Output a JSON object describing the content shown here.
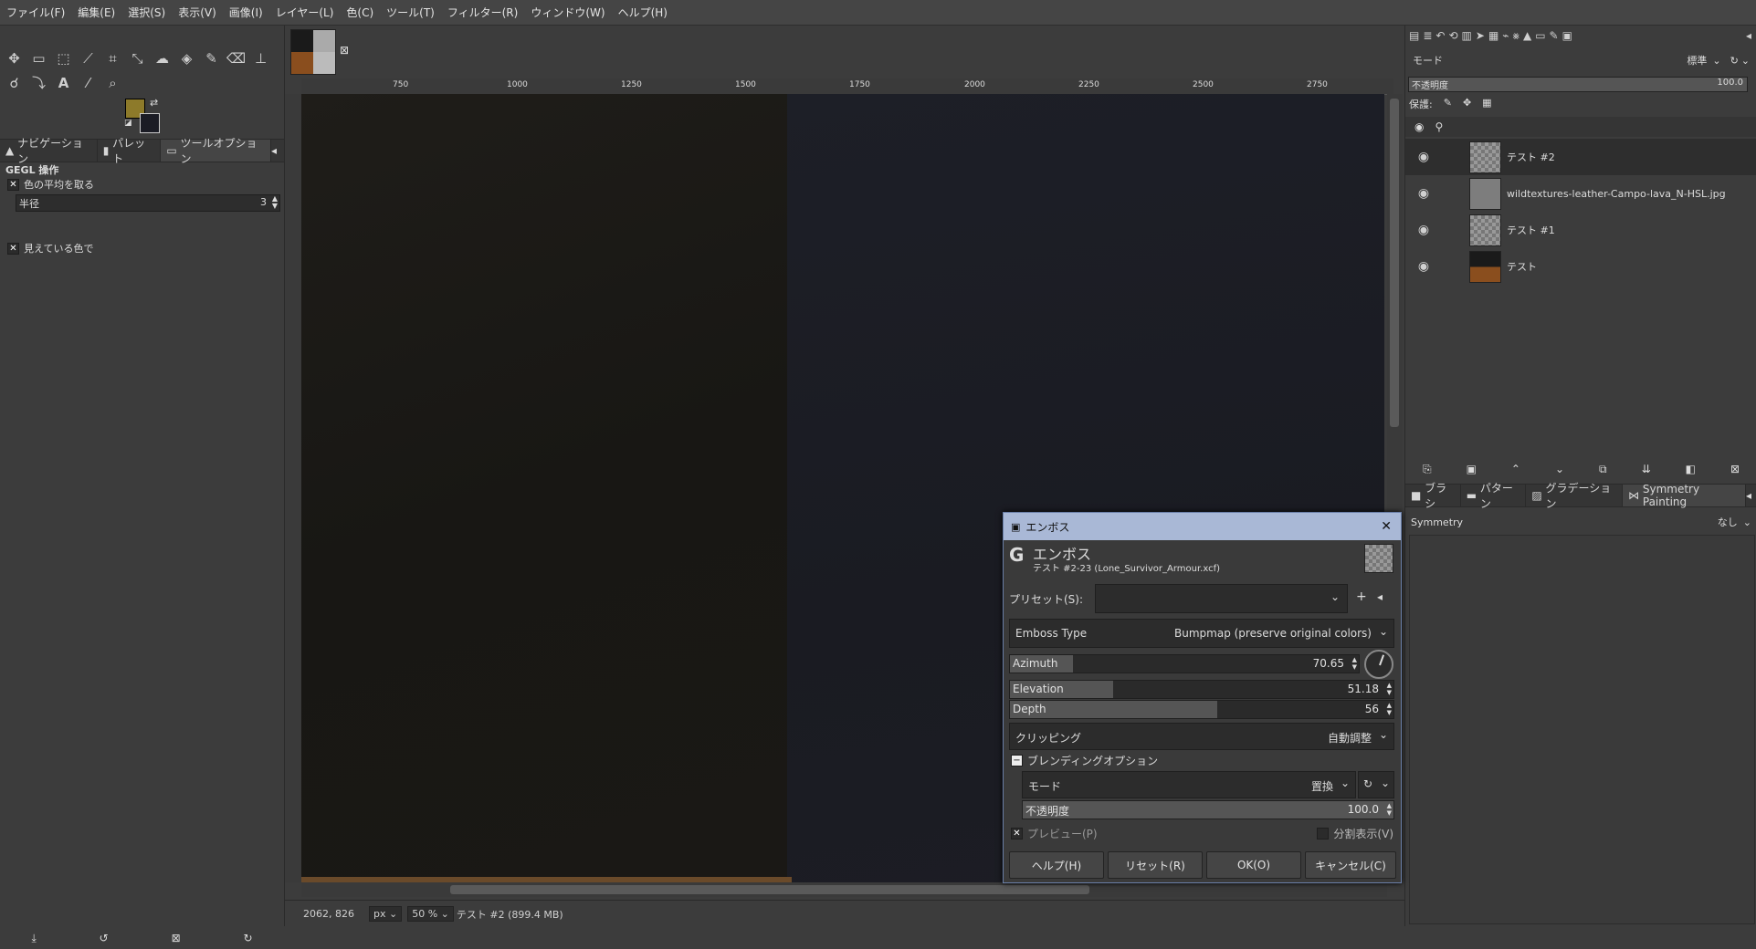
{
  "menu": [
    "ファイル(F)",
    "編集(E)",
    "選択(S)",
    "表示(V)",
    "画像(I)",
    "レイヤー(L)",
    "色(C)",
    "ツール(T)",
    "フィルター(R)",
    "ウィンドウ(W)",
    "ヘルプ(H)"
  ],
  "toolbox": {
    "tools": [
      "move-icon",
      "rect-select-icon",
      "free-select-icon",
      "fuzzy-select-icon",
      "crop-icon",
      "transform-icon",
      "warp-icon",
      "bucket-icon",
      "paintbrush-icon",
      "eraser-icon",
      "clone-icon",
      "smudge-icon",
      "path-icon",
      "text-icon",
      "color-picker-icon",
      "zoom-icon"
    ],
    "fg_color": "#8d7a2a",
    "bg_color": "#1b1c25",
    "tabs": [
      "ナビゲーション",
      "パレット",
      "ツールオプション"
    ],
    "options_title": "GEGL 操作",
    "opt_average": "色の平均を取る",
    "radius_label": "半径",
    "radius_value": "3",
    "opt_visible": "見えている色で"
  },
  "ruler_top": [
    "750",
    "1000",
    "1250",
    "1500",
    "1750",
    "2000",
    "2250",
    "2500",
    "2750"
  ],
  "statusbar": {
    "coords": "2062, 826",
    "unit": "px",
    "zoom": "50 %",
    "info": "テスト #2 (899.4 MB)"
  },
  "layers_panel": {
    "mode_label": "モード",
    "mode_value": "標準",
    "opacity_label": "不透明度",
    "opacity_value": "100.0",
    "lock_label": "保護:",
    "layers": [
      {
        "name": "テスト #2"
      },
      {
        "name": "wildtextures-leather-Campo-lava_N-HSL.jpg"
      },
      {
        "name": "テスト #1"
      },
      {
        "name": "テスト"
      }
    ]
  },
  "brushes_panel": {
    "tabs": [
      "ブラシ",
      "パターン",
      "グラデーション",
      "Symmetry Painting"
    ],
    "symmetry_label": "Symmetry",
    "symmetry_value": "なし"
  },
  "dialog": {
    "window_title": "エンボス",
    "title": "エンボス",
    "subtitle": "テスト #2-23 (Lone_Survivor_Armour.xcf)",
    "preset_label": "プリセット(S):",
    "emboss_type_label": "Emboss Type",
    "emboss_type_value": "Bumpmap (preserve original colors)",
    "azimuth_label": "Azimuth",
    "azimuth_value": "70.65",
    "azimuth_fill": 0.18,
    "elevation_label": "Elevation",
    "elevation_value": "51.18",
    "elevation_fill": 0.27,
    "depth_label": "Depth",
    "depth_value": "56",
    "depth_fill": 0.54,
    "clipping_label": "クリッピング",
    "clipping_value": "自動調整",
    "blend_section": "ブレンディングオプション",
    "blend_mode_label": "モード",
    "blend_mode_value": "置換",
    "blend_opacity_label": "不透明度",
    "blend_opacity_value": "100.0",
    "preview_label": "プレビュー(P)",
    "split_label": "分割表示(V)",
    "buttons": {
      "help": "ヘルプ(H)",
      "reset": "リセット(R)",
      "ok": "OK(O)",
      "cancel": "キャンセル(C)"
    }
  }
}
